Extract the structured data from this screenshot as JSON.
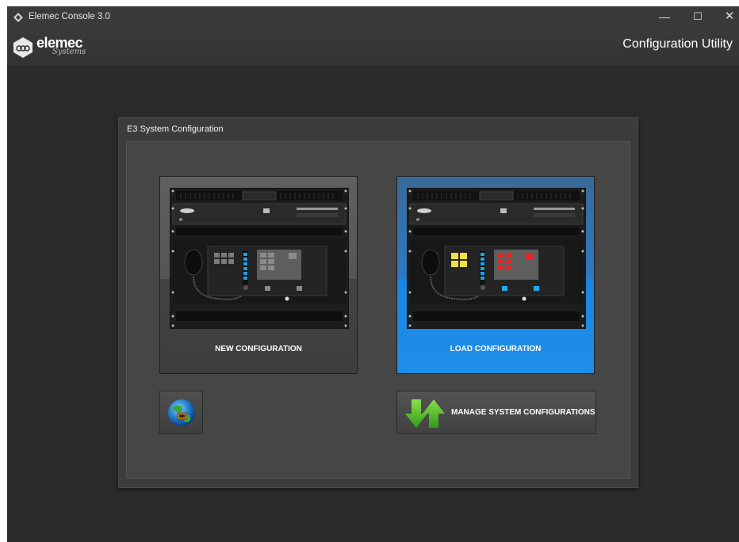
{
  "window": {
    "title": "Elemec Console 3.0",
    "controls": {
      "minimize": "—",
      "maximize": "☐",
      "close": "✕"
    }
  },
  "header": {
    "logo_text": "elemec",
    "logo_subtext": "Systems",
    "title": "Configuration Utility"
  },
  "panel": {
    "title": "E3 System Configuration",
    "cards": [
      {
        "label": "NEW CONFIGURATION",
        "state": "normal"
      },
      {
        "label": "LOAD CONFIGURATION",
        "state": "selected"
      }
    ],
    "buttons": {
      "network_icon": "globe-network-icon",
      "manage_label": "MANAGE SYSTEM CONFIGURATIONS",
      "manage_icon": "up-down-arrows-icon"
    }
  },
  "colors": {
    "background": "#2b2b2b",
    "panel": "#3c3c3c",
    "selected_card": "#1f8ee8",
    "accent_green": "#3fbf2a"
  }
}
